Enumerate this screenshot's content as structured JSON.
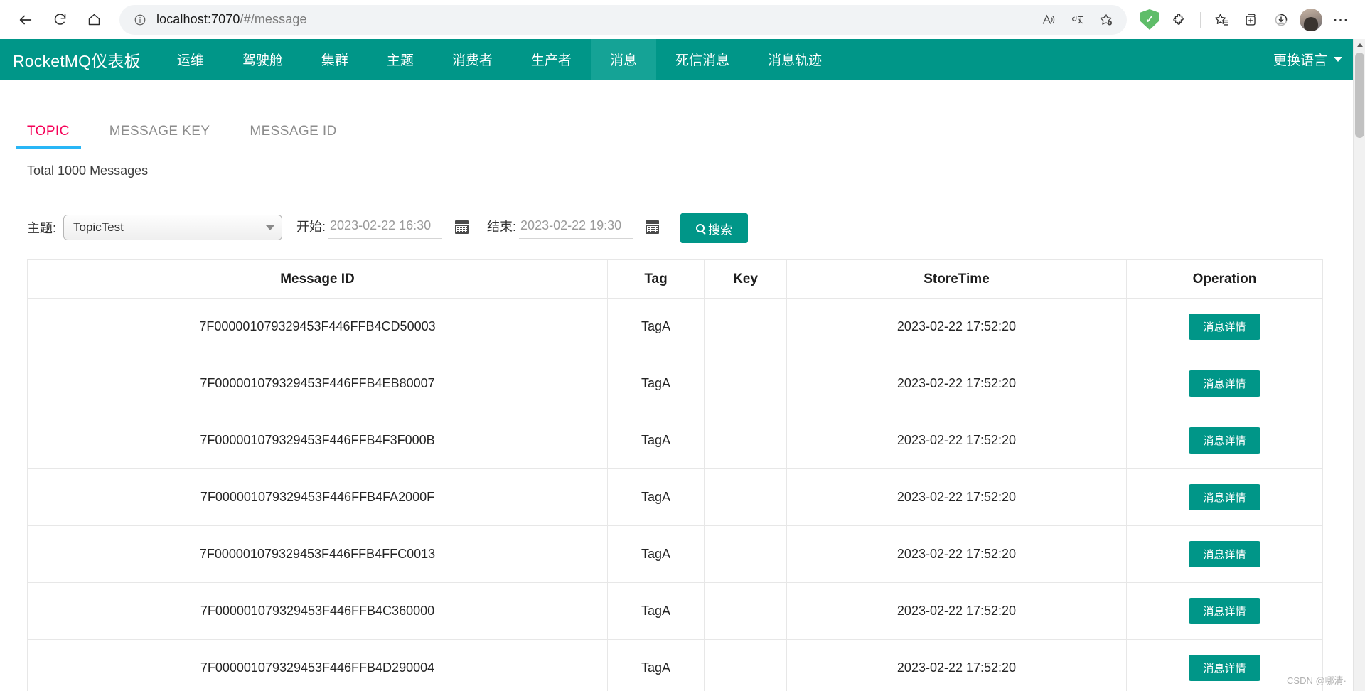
{
  "browser": {
    "back_label": "back-arrow",
    "reload_label": "reload",
    "home_label": "home",
    "url_host": "localhost:7070",
    "url_path": "/#/message",
    "icons": {
      "info": "info-icon",
      "read_aloud": "read-aloud-icon",
      "translate": "translate-icon",
      "add_favorite": "add-favorite-icon",
      "adblock": "adblock-shield-icon",
      "extensions": "extensions-icon",
      "collections": "collections-icon",
      "favorites": "favorites-icon",
      "split_screen": "split-screen-icon",
      "downloads": "downloads-icon",
      "profile": "profile-avatar",
      "more": "more-settings-icon"
    },
    "more_label": "⋯"
  },
  "appnav": {
    "brand": "RocketMQ仪表板",
    "items": [
      {
        "label": "运维",
        "active": false
      },
      {
        "label": "驾驶舱",
        "active": false
      },
      {
        "label": "集群",
        "active": false
      },
      {
        "label": "主题",
        "active": false
      },
      {
        "label": "消费者",
        "active": false
      },
      {
        "label": "生产者",
        "active": false
      },
      {
        "label": "消息",
        "active": true
      },
      {
        "label": "死信消息",
        "active": false
      },
      {
        "label": "消息轨迹",
        "active": false
      }
    ],
    "language_label": "更换语言",
    "accent_color": "#009688",
    "active_color": "#15a396"
  },
  "tabs": [
    {
      "label": "TOPIC",
      "active": true
    },
    {
      "label": "MESSAGE KEY",
      "active": false
    },
    {
      "label": "MESSAGE ID",
      "active": false
    }
  ],
  "tab_active_color": "#f50057",
  "tab_underline_color": "#29b6f6",
  "total_text": "Total 1000 Messages",
  "search": {
    "topic_label": "主题:",
    "topic_value": "TopicTest",
    "begin_label": "开始:",
    "begin_value": "2023-02-22 16:30",
    "end_label": "结束:",
    "end_value": "2023-02-22 19:30",
    "search_button": "搜索"
  },
  "table": {
    "columns": [
      "Message ID",
      "Tag",
      "Key",
      "StoreTime",
      "Operation"
    ],
    "operation_label": "消息详情",
    "rows": [
      {
        "id": "7F000001079329453F446FFB4CD50003",
        "tag": "TagA",
        "key": "",
        "store_time": "2023-02-22 17:52:20"
      },
      {
        "id": "7F000001079329453F446FFB4EB80007",
        "tag": "TagA",
        "key": "",
        "store_time": "2023-02-22 17:52:20"
      },
      {
        "id": "7F000001079329453F446FFB4F3F000B",
        "tag": "TagA",
        "key": "",
        "store_time": "2023-02-22 17:52:20"
      },
      {
        "id": "7F000001079329453F446FFB4FA2000F",
        "tag": "TagA",
        "key": "",
        "store_time": "2023-02-22 17:52:20"
      },
      {
        "id": "7F000001079329453F446FFB4FFC0013",
        "tag": "TagA",
        "key": "",
        "store_time": "2023-02-22 17:52:20"
      },
      {
        "id": "7F000001079329453F446FFB4C360000",
        "tag": "TagA",
        "key": "",
        "store_time": "2023-02-22 17:52:20"
      },
      {
        "id": "7F000001079329453F446FFB4D290004",
        "tag": "TagA",
        "key": "",
        "store_time": "2023-02-22 17:52:20"
      }
    ]
  },
  "watermark": "CSDN @哪清·"
}
